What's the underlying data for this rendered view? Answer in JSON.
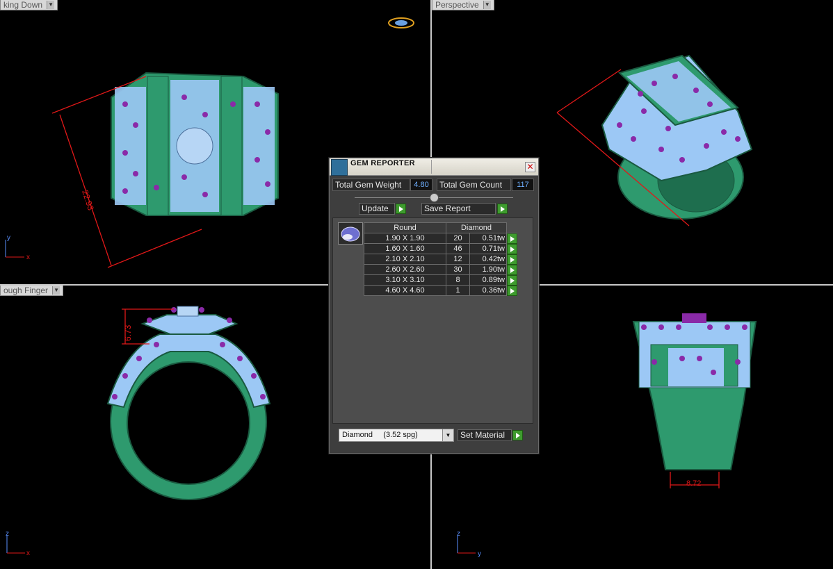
{
  "viewports": {
    "top_left": {
      "label": "king Down"
    },
    "top_right": {
      "label": "Perspective"
    },
    "bottom_left": {
      "label": "ough Finger"
    },
    "bottom_right": {
      "label": ""
    }
  },
  "dimensions": {
    "top_left": "22.93",
    "bottom_left": "6.73",
    "bottom_right": "8.72"
  },
  "axes": {
    "top_left": {
      "v": "y",
      "h": "x"
    },
    "bottom_left": {
      "v": "z",
      "h": "x"
    },
    "bottom_right": {
      "v": "z",
      "h": "y"
    }
  },
  "dialog": {
    "title": "GEM REPORTER",
    "total_weight_label": "Total Gem Weight",
    "total_weight_value": "4.80",
    "total_count_label": "Total Gem Count",
    "total_count_value": "117",
    "update_label": "Update",
    "save_report_label": "Save Report",
    "table": {
      "header_shape": "Round",
      "header_material": "Diamond",
      "rows": [
        {
          "size": "1.90 X 1.90",
          "count": "20",
          "weight": "0.51tw"
        },
        {
          "size": "1.60 X 1.60",
          "count": "46",
          "weight": "0.71tw"
        },
        {
          "size": "2.10 X 2.10",
          "count": "12",
          "weight": "0.42tw"
        },
        {
          "size": "2.60 X 2.60",
          "count": "30",
          "weight": "1.90tw"
        },
        {
          "size": "3.10 X 3.10",
          "count": "8",
          "weight": "0.89tw"
        },
        {
          "size": "4.60 X 4.60",
          "count": "1",
          "weight": "0.36tw"
        }
      ]
    },
    "material_select": "Diamond     (3.52 spg)",
    "set_material_label": "Set Material"
  },
  "colors": {
    "metal": "#2e9a6e",
    "metal_edge": "#1a5a40",
    "stone": "#9cc8f5",
    "prong": "#8a2aa8",
    "dimension": "#e01818",
    "accent_green": "#3e9b2e"
  }
}
